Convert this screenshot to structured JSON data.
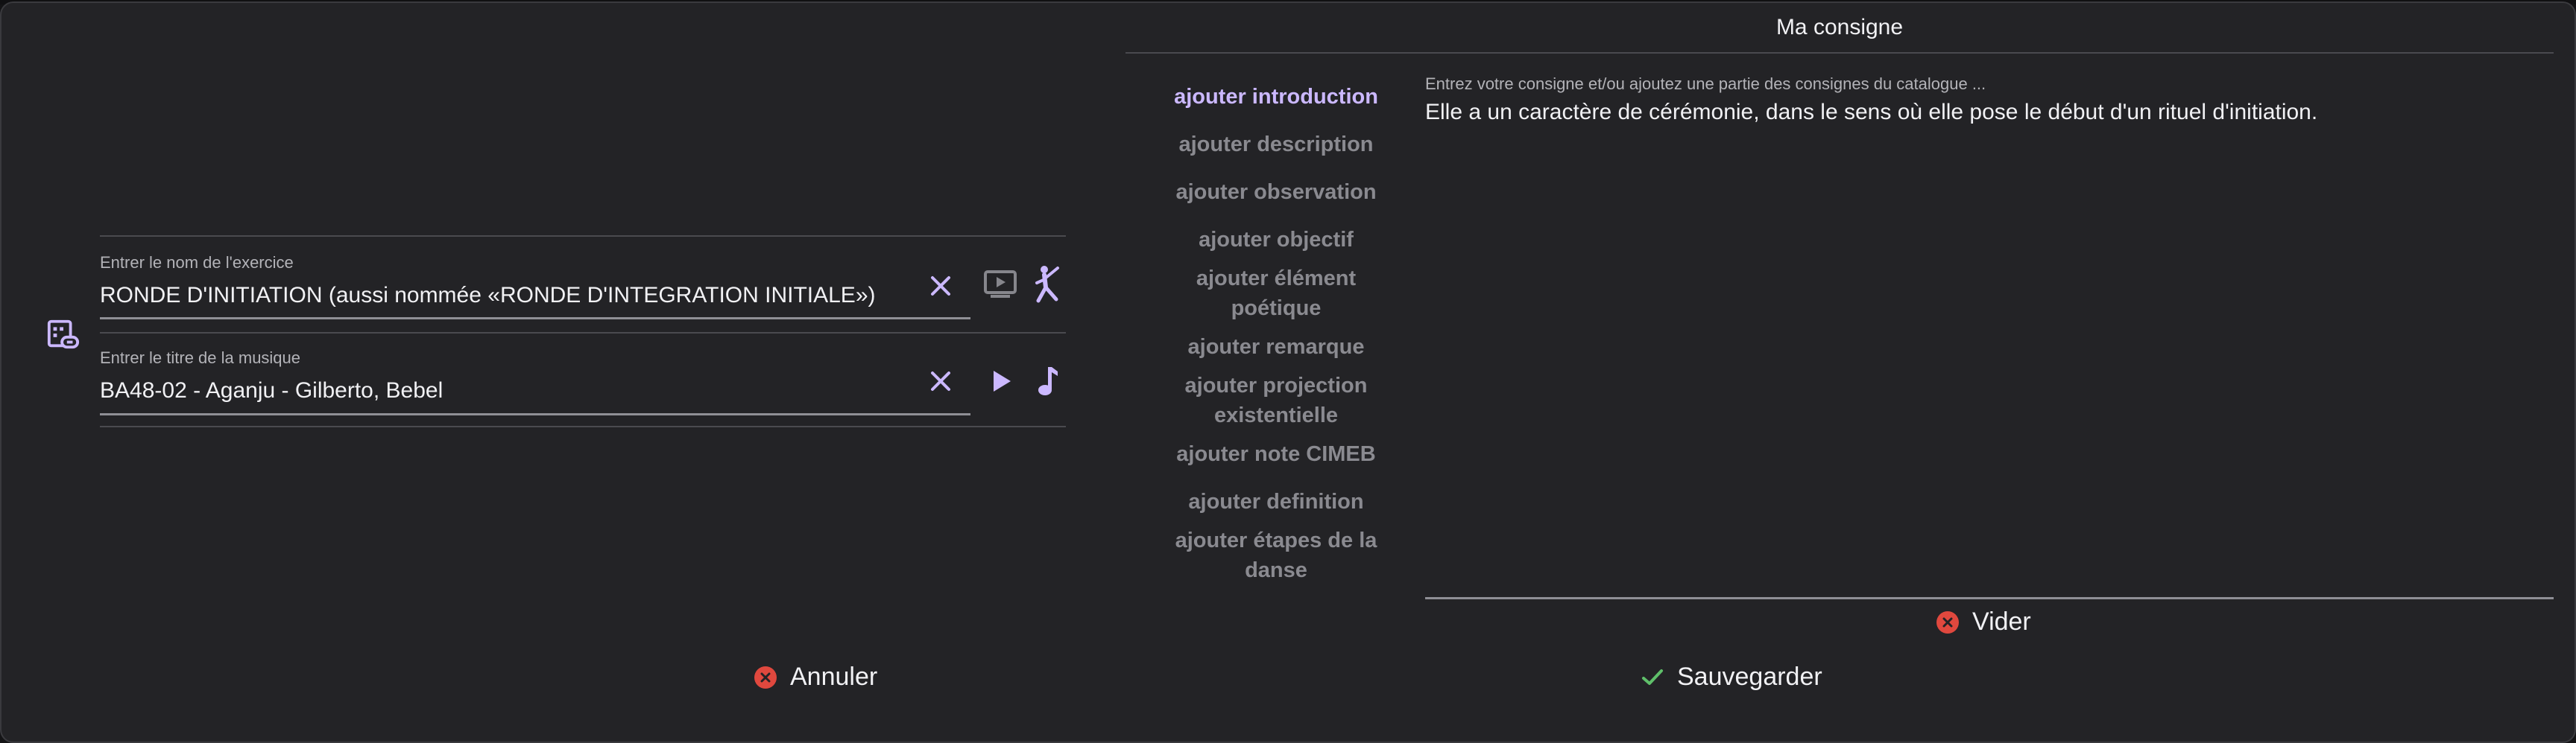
{
  "exercise": {
    "label": "Entrer le nom de l'exercice",
    "value": "RONDE D'INITIATION (aussi nommée «RONDE D'INTEGRATION INITIALE»)"
  },
  "music": {
    "label": "Entrer le titre de la musique",
    "value": "BA48-02 - Aganju - Gilberto, Bebel"
  },
  "panel": {
    "title": "Ma consigne",
    "menu": [
      {
        "label": "ajouter introduction",
        "active": true
      },
      {
        "label": "ajouter description"
      },
      {
        "label": "ajouter observation"
      },
      {
        "label": "ajouter objectif"
      },
      {
        "label": "ajouter élément poétique"
      },
      {
        "label": "ajouter remarque"
      },
      {
        "label": "ajouter projection existentielle"
      },
      {
        "label": "ajouter note CIMEB"
      },
      {
        "label": "ajouter definition"
      },
      {
        "label": "ajouter étapes de la danse"
      }
    ],
    "editor_label": "Entrez votre consigne et/ou ajoutez une partie des consignes du catalogue ...",
    "editor_text": "Elle a un caractère de cérémonie, dans le sens où elle pose le début d'un rituel d'initiation.",
    "clear_label": "Vider"
  },
  "footer": {
    "cancel_label": "Annuler",
    "save_label": "Sauvegarder"
  },
  "colors": {
    "accent": "#cbb8ff",
    "danger": "#e0483e",
    "success": "#5fbf6a",
    "background": "#232326"
  },
  "icons": {
    "left": "calendar-link-icon",
    "clear": "close-icon",
    "video": "video-player-icon",
    "dance": "dancer-icon",
    "play": "play-icon",
    "note": "music-note-icon",
    "save": "check-icon"
  }
}
